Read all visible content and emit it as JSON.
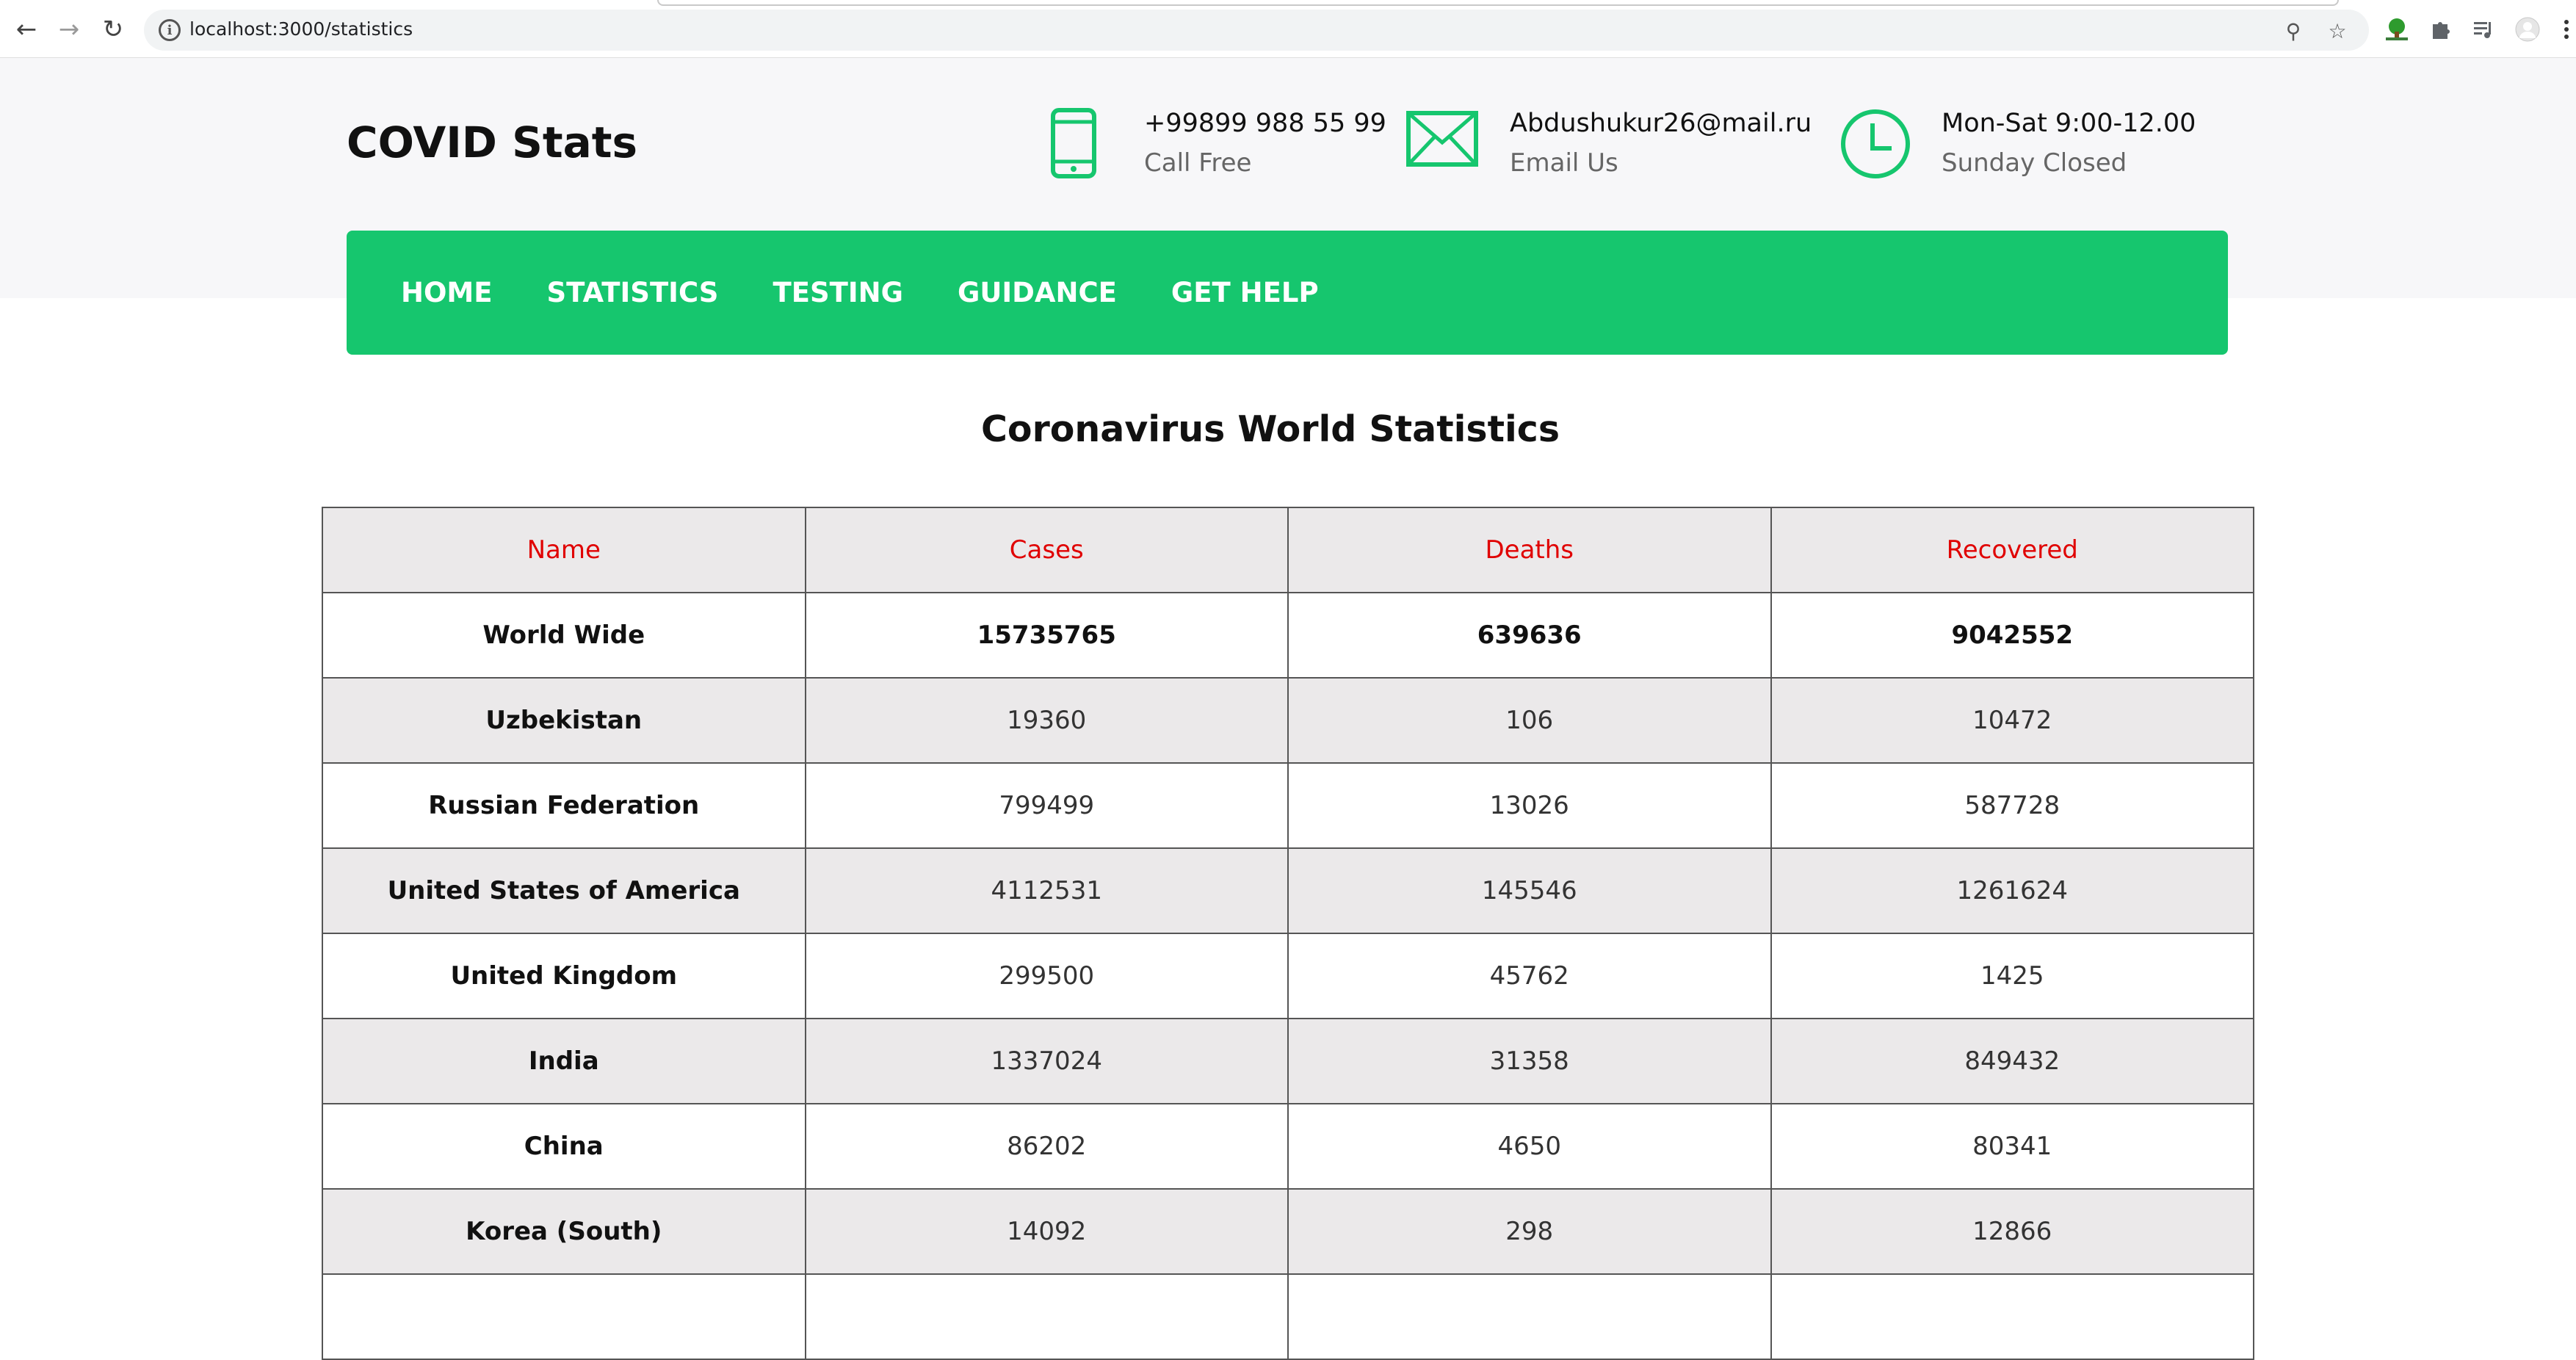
{
  "browser": {
    "url": "localhost:3000/statistics"
  },
  "site": {
    "logo": "COVID Stats",
    "contacts": {
      "phone": {
        "main": "+99899 988 55 99",
        "sub": "Call Free"
      },
      "email": {
        "main": "Abdushukur26@mail.ru",
        "sub": "Email Us"
      },
      "hours": {
        "main": "Mon-Sat 9:00-12.00",
        "sub": "Sunday Closed"
      }
    },
    "accent_color": "#16c66e"
  },
  "nav": {
    "items": [
      "HOME",
      "STATISTICS",
      "TESTING",
      "GUIDANCE",
      "GET HELP"
    ]
  },
  "page": {
    "title": "Coronavirus World Statistics"
  },
  "table": {
    "header_color": "#e00000",
    "columns": [
      "Name",
      "Cases",
      "Deaths",
      "Recovered"
    ],
    "rows": [
      {
        "name": "World Wide",
        "cases": "15735765",
        "deaths": "639636",
        "recovered": "9042552"
      },
      {
        "name": "Uzbekistan",
        "cases": "19360",
        "deaths": "106",
        "recovered": "10472"
      },
      {
        "name": "Russian Federation",
        "cases": "799499",
        "deaths": "13026",
        "recovered": "587728"
      },
      {
        "name": "United States of America",
        "cases": "4112531",
        "deaths": "145546",
        "recovered": "1261624"
      },
      {
        "name": "United Kingdom",
        "cases": "299500",
        "deaths": "45762",
        "recovered": "1425"
      },
      {
        "name": "India",
        "cases": "1337024",
        "deaths": "31358",
        "recovered": "849432"
      },
      {
        "name": "China",
        "cases": "86202",
        "deaths": "4650",
        "recovered": "80341"
      },
      {
        "name": "Korea (South)",
        "cases": "14092",
        "deaths": "298",
        "recovered": "12866"
      },
      {
        "name": "",
        "cases": "",
        "deaths": "",
        "recovered": ""
      }
    ]
  }
}
